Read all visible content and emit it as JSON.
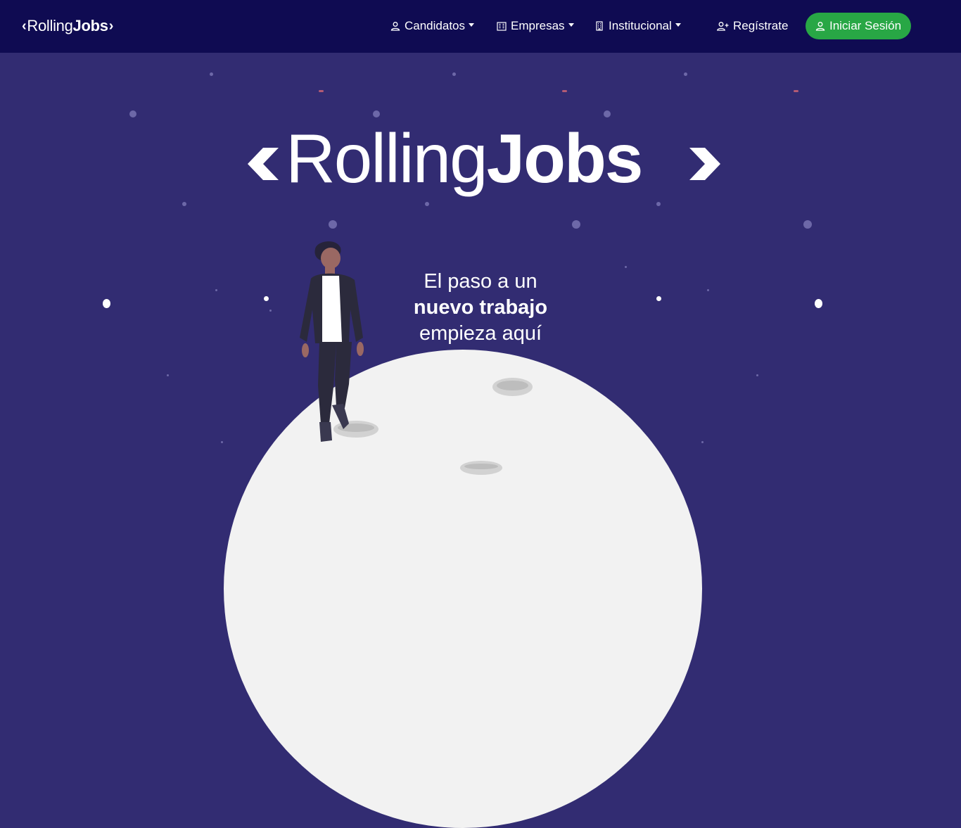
{
  "brand": {
    "light": "Rolling",
    "bold": "Jobs"
  },
  "nav": {
    "candidatos": "Candidatos",
    "empresas": "Empresas",
    "institucional": "Institucional",
    "registrate": "Regístrate",
    "login": "Iniciar Sesión"
  },
  "hero": {
    "logo_light": "Rolling",
    "logo_bold": "Jobs",
    "tagline_line1": "El paso a un",
    "tagline_line2": "nuevo trabajo",
    "tagline_line3": "empieza aquí"
  },
  "colors": {
    "navbar": "#0f0b52",
    "background": "#322c72",
    "login_button": "#28a745",
    "moon": "#f2f2f2"
  },
  "icons": {
    "candidatos": "person-icon",
    "empresas": "building-icon",
    "institucional": "institution-icon",
    "registrate": "person-add-icon",
    "login": "person-icon"
  }
}
